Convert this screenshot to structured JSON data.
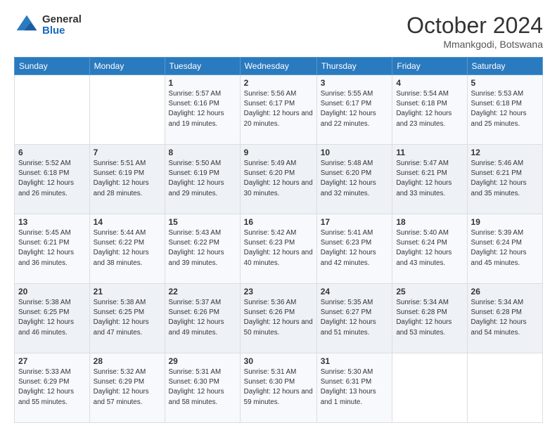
{
  "logo": {
    "general": "General",
    "blue": "Blue"
  },
  "header": {
    "month": "October 2024",
    "location": "Mmankgodi, Botswana"
  },
  "weekdays": [
    "Sunday",
    "Monday",
    "Tuesday",
    "Wednesday",
    "Thursday",
    "Friday",
    "Saturday"
  ],
  "weeks": [
    [
      {
        "day": "",
        "info": ""
      },
      {
        "day": "",
        "info": ""
      },
      {
        "day": "1",
        "info": "Sunrise: 5:57 AM\nSunset: 6:16 PM\nDaylight: 12 hours and 19 minutes."
      },
      {
        "day": "2",
        "info": "Sunrise: 5:56 AM\nSunset: 6:17 PM\nDaylight: 12 hours and 20 minutes."
      },
      {
        "day": "3",
        "info": "Sunrise: 5:55 AM\nSunset: 6:17 PM\nDaylight: 12 hours and 22 minutes."
      },
      {
        "day": "4",
        "info": "Sunrise: 5:54 AM\nSunset: 6:18 PM\nDaylight: 12 hours and 23 minutes."
      },
      {
        "day": "5",
        "info": "Sunrise: 5:53 AM\nSunset: 6:18 PM\nDaylight: 12 hours and 25 minutes."
      }
    ],
    [
      {
        "day": "6",
        "info": "Sunrise: 5:52 AM\nSunset: 6:18 PM\nDaylight: 12 hours and 26 minutes."
      },
      {
        "day": "7",
        "info": "Sunrise: 5:51 AM\nSunset: 6:19 PM\nDaylight: 12 hours and 28 minutes."
      },
      {
        "day": "8",
        "info": "Sunrise: 5:50 AM\nSunset: 6:19 PM\nDaylight: 12 hours and 29 minutes."
      },
      {
        "day": "9",
        "info": "Sunrise: 5:49 AM\nSunset: 6:20 PM\nDaylight: 12 hours and 30 minutes."
      },
      {
        "day": "10",
        "info": "Sunrise: 5:48 AM\nSunset: 6:20 PM\nDaylight: 12 hours and 32 minutes."
      },
      {
        "day": "11",
        "info": "Sunrise: 5:47 AM\nSunset: 6:21 PM\nDaylight: 12 hours and 33 minutes."
      },
      {
        "day": "12",
        "info": "Sunrise: 5:46 AM\nSunset: 6:21 PM\nDaylight: 12 hours and 35 minutes."
      }
    ],
    [
      {
        "day": "13",
        "info": "Sunrise: 5:45 AM\nSunset: 6:21 PM\nDaylight: 12 hours and 36 minutes."
      },
      {
        "day": "14",
        "info": "Sunrise: 5:44 AM\nSunset: 6:22 PM\nDaylight: 12 hours and 38 minutes."
      },
      {
        "day": "15",
        "info": "Sunrise: 5:43 AM\nSunset: 6:22 PM\nDaylight: 12 hours and 39 minutes."
      },
      {
        "day": "16",
        "info": "Sunrise: 5:42 AM\nSunset: 6:23 PM\nDaylight: 12 hours and 40 minutes."
      },
      {
        "day": "17",
        "info": "Sunrise: 5:41 AM\nSunset: 6:23 PM\nDaylight: 12 hours and 42 minutes."
      },
      {
        "day": "18",
        "info": "Sunrise: 5:40 AM\nSunset: 6:24 PM\nDaylight: 12 hours and 43 minutes."
      },
      {
        "day": "19",
        "info": "Sunrise: 5:39 AM\nSunset: 6:24 PM\nDaylight: 12 hours and 45 minutes."
      }
    ],
    [
      {
        "day": "20",
        "info": "Sunrise: 5:38 AM\nSunset: 6:25 PM\nDaylight: 12 hours and 46 minutes."
      },
      {
        "day": "21",
        "info": "Sunrise: 5:38 AM\nSunset: 6:25 PM\nDaylight: 12 hours and 47 minutes."
      },
      {
        "day": "22",
        "info": "Sunrise: 5:37 AM\nSunset: 6:26 PM\nDaylight: 12 hours and 49 minutes."
      },
      {
        "day": "23",
        "info": "Sunrise: 5:36 AM\nSunset: 6:26 PM\nDaylight: 12 hours and 50 minutes."
      },
      {
        "day": "24",
        "info": "Sunrise: 5:35 AM\nSunset: 6:27 PM\nDaylight: 12 hours and 51 minutes."
      },
      {
        "day": "25",
        "info": "Sunrise: 5:34 AM\nSunset: 6:28 PM\nDaylight: 12 hours and 53 minutes."
      },
      {
        "day": "26",
        "info": "Sunrise: 5:34 AM\nSunset: 6:28 PM\nDaylight: 12 hours and 54 minutes."
      }
    ],
    [
      {
        "day": "27",
        "info": "Sunrise: 5:33 AM\nSunset: 6:29 PM\nDaylight: 12 hours and 55 minutes."
      },
      {
        "day": "28",
        "info": "Sunrise: 5:32 AM\nSunset: 6:29 PM\nDaylight: 12 hours and 57 minutes."
      },
      {
        "day": "29",
        "info": "Sunrise: 5:31 AM\nSunset: 6:30 PM\nDaylight: 12 hours and 58 minutes."
      },
      {
        "day": "30",
        "info": "Sunrise: 5:31 AM\nSunset: 6:30 PM\nDaylight: 12 hours and 59 minutes."
      },
      {
        "day": "31",
        "info": "Sunrise: 5:30 AM\nSunset: 6:31 PM\nDaylight: 13 hours and 1 minute."
      },
      {
        "day": "",
        "info": ""
      },
      {
        "day": "",
        "info": ""
      }
    ]
  ]
}
